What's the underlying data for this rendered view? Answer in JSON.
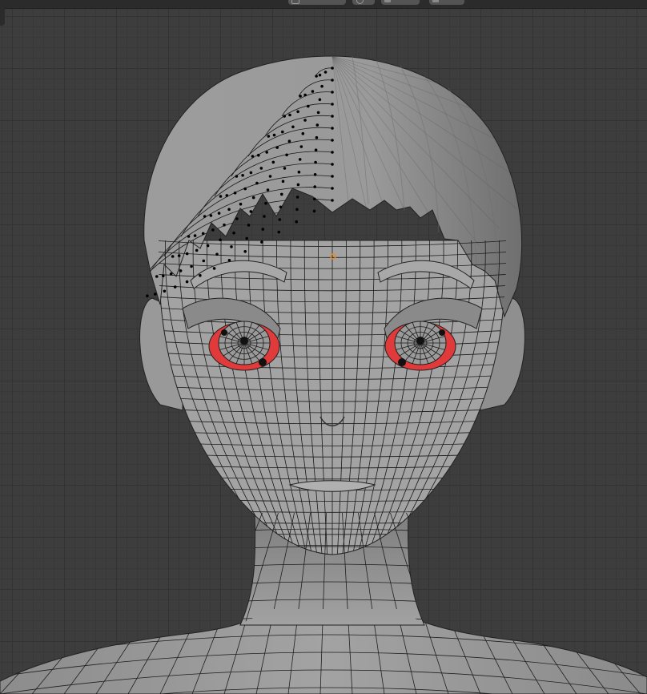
{
  "viewport": {
    "background_color": "#3d3d3d",
    "grid_major_color": "#333333",
    "grid_minor_color": "#383838"
  },
  "header": {
    "menu_items": [
      "",
      "",
      "",
      "",
      ""
    ],
    "toolbar_icons": [
      "transform-orientation-icon",
      "pivot-icon",
      "snap-icon",
      "proportional-edit-icon"
    ]
  },
  "model": {
    "mesh_color": "#9e9e9e",
    "wire_color": "#1a1a1a",
    "selected_vertex_color": "#000000",
    "selected_face_color": "#e03a3a",
    "origin_color": "#e8892b",
    "mode": "edit-mode"
  }
}
